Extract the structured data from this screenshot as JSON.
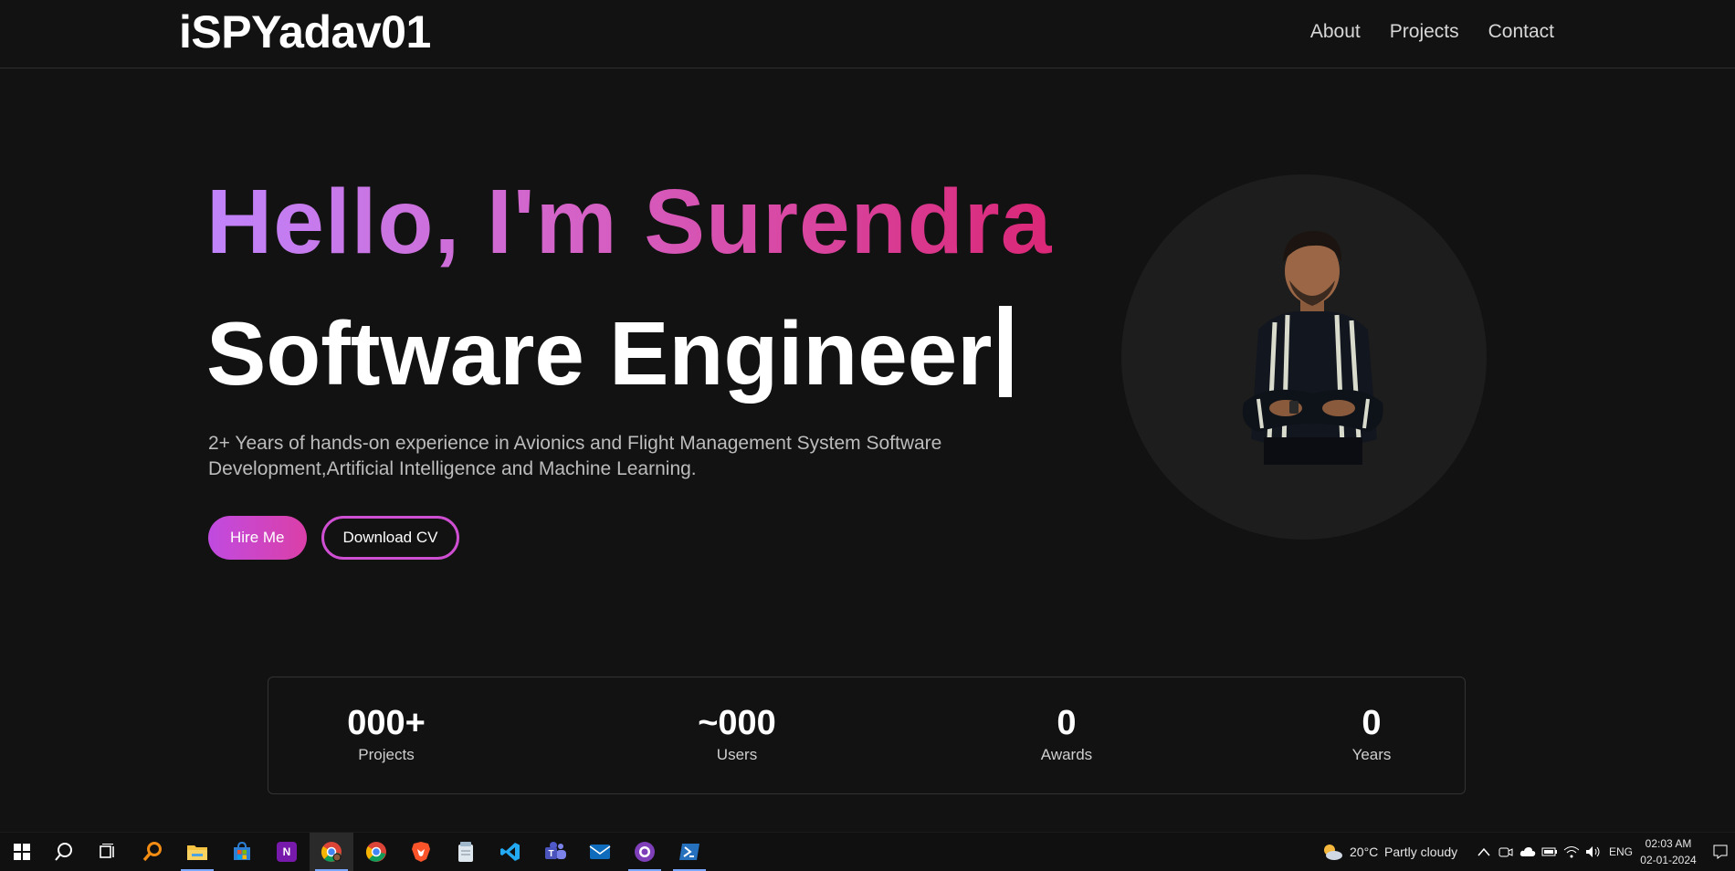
{
  "header": {
    "logo": "iSPYadav01",
    "nav": [
      "About",
      "Projects",
      "Contact"
    ]
  },
  "hero": {
    "greeting": "Hello, I'm Surendra",
    "role": "Software Engineer",
    "description": "2+ Years of hands-on experience in Avionics and Flight Management System Software Development,Artificial Intelligence and Machine Learning.",
    "hire_label": "Hire Me",
    "cv_label": "Download CV",
    "gradient": [
      "#c084fc",
      "#db2777"
    ]
  },
  "stats": [
    {
      "value": "000+",
      "label": "Projects"
    },
    {
      "value": "~000",
      "label": "Users"
    },
    {
      "value": "0",
      "label": "Awards"
    },
    {
      "value": "0",
      "label": "Years"
    }
  ],
  "taskbar": {
    "apps": [
      "windows-start-icon",
      "search-icon",
      "task-view-icon",
      "magnifier-app-icon",
      "file-explorer-icon",
      "microsoft-store-icon",
      "onenote-icon",
      "chrome-profile-icon",
      "chrome-icon",
      "brave-icon",
      "notepad-icon",
      "vscode-icon",
      "teams-icon",
      "mail-icon",
      "github-desktop-icon",
      "powershell-icon"
    ],
    "weather_temp": "20°C",
    "weather_text": "Partly cloudy",
    "language": "ENG",
    "time": "02:03 AM",
    "date": "02-01-2024"
  }
}
